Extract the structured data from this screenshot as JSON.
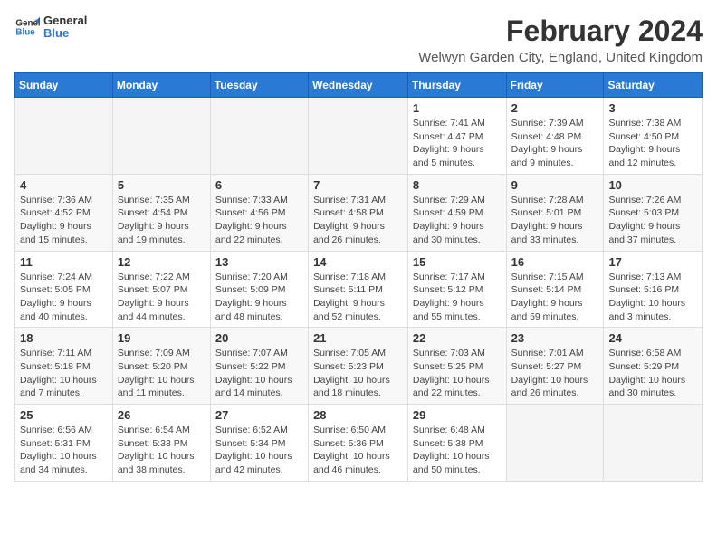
{
  "logo": {
    "text_general": "General",
    "text_blue": "Blue"
  },
  "header": {
    "title": "February 2024",
    "subtitle": "Welwyn Garden City, England, United Kingdom"
  },
  "weekdays": [
    "Sunday",
    "Monday",
    "Tuesday",
    "Wednesday",
    "Thursday",
    "Friday",
    "Saturday"
  ],
  "weeks": [
    [
      {
        "day": "",
        "info": ""
      },
      {
        "day": "",
        "info": ""
      },
      {
        "day": "",
        "info": ""
      },
      {
        "day": "",
        "info": ""
      },
      {
        "day": "1",
        "info": "Sunrise: 7:41 AM\nSunset: 4:47 PM\nDaylight: 9 hours\nand 5 minutes."
      },
      {
        "day": "2",
        "info": "Sunrise: 7:39 AM\nSunset: 4:48 PM\nDaylight: 9 hours\nand 9 minutes."
      },
      {
        "day": "3",
        "info": "Sunrise: 7:38 AM\nSunset: 4:50 PM\nDaylight: 9 hours\nand 12 minutes."
      }
    ],
    [
      {
        "day": "4",
        "info": "Sunrise: 7:36 AM\nSunset: 4:52 PM\nDaylight: 9 hours\nand 15 minutes."
      },
      {
        "day": "5",
        "info": "Sunrise: 7:35 AM\nSunset: 4:54 PM\nDaylight: 9 hours\nand 19 minutes."
      },
      {
        "day": "6",
        "info": "Sunrise: 7:33 AM\nSunset: 4:56 PM\nDaylight: 9 hours\nand 22 minutes."
      },
      {
        "day": "7",
        "info": "Sunrise: 7:31 AM\nSunset: 4:58 PM\nDaylight: 9 hours\nand 26 minutes."
      },
      {
        "day": "8",
        "info": "Sunrise: 7:29 AM\nSunset: 4:59 PM\nDaylight: 9 hours\nand 30 minutes."
      },
      {
        "day": "9",
        "info": "Sunrise: 7:28 AM\nSunset: 5:01 PM\nDaylight: 9 hours\nand 33 minutes."
      },
      {
        "day": "10",
        "info": "Sunrise: 7:26 AM\nSunset: 5:03 PM\nDaylight: 9 hours\nand 37 minutes."
      }
    ],
    [
      {
        "day": "11",
        "info": "Sunrise: 7:24 AM\nSunset: 5:05 PM\nDaylight: 9 hours\nand 40 minutes."
      },
      {
        "day": "12",
        "info": "Sunrise: 7:22 AM\nSunset: 5:07 PM\nDaylight: 9 hours\nand 44 minutes."
      },
      {
        "day": "13",
        "info": "Sunrise: 7:20 AM\nSunset: 5:09 PM\nDaylight: 9 hours\nand 48 minutes."
      },
      {
        "day": "14",
        "info": "Sunrise: 7:18 AM\nSunset: 5:11 PM\nDaylight: 9 hours\nand 52 minutes."
      },
      {
        "day": "15",
        "info": "Sunrise: 7:17 AM\nSunset: 5:12 PM\nDaylight: 9 hours\nand 55 minutes."
      },
      {
        "day": "16",
        "info": "Sunrise: 7:15 AM\nSunset: 5:14 PM\nDaylight: 9 hours\nand 59 minutes."
      },
      {
        "day": "17",
        "info": "Sunrise: 7:13 AM\nSunset: 5:16 PM\nDaylight: 10 hours\nand 3 minutes."
      }
    ],
    [
      {
        "day": "18",
        "info": "Sunrise: 7:11 AM\nSunset: 5:18 PM\nDaylight: 10 hours\nand 7 minutes."
      },
      {
        "day": "19",
        "info": "Sunrise: 7:09 AM\nSunset: 5:20 PM\nDaylight: 10 hours\nand 11 minutes."
      },
      {
        "day": "20",
        "info": "Sunrise: 7:07 AM\nSunset: 5:22 PM\nDaylight: 10 hours\nand 14 minutes."
      },
      {
        "day": "21",
        "info": "Sunrise: 7:05 AM\nSunset: 5:23 PM\nDaylight: 10 hours\nand 18 minutes."
      },
      {
        "day": "22",
        "info": "Sunrise: 7:03 AM\nSunset: 5:25 PM\nDaylight: 10 hours\nand 22 minutes."
      },
      {
        "day": "23",
        "info": "Sunrise: 7:01 AM\nSunset: 5:27 PM\nDaylight: 10 hours\nand 26 minutes."
      },
      {
        "day": "24",
        "info": "Sunrise: 6:58 AM\nSunset: 5:29 PM\nDaylight: 10 hours\nand 30 minutes."
      }
    ],
    [
      {
        "day": "25",
        "info": "Sunrise: 6:56 AM\nSunset: 5:31 PM\nDaylight: 10 hours\nand 34 minutes."
      },
      {
        "day": "26",
        "info": "Sunrise: 6:54 AM\nSunset: 5:33 PM\nDaylight: 10 hours\nand 38 minutes."
      },
      {
        "day": "27",
        "info": "Sunrise: 6:52 AM\nSunset: 5:34 PM\nDaylight: 10 hours\nand 42 minutes."
      },
      {
        "day": "28",
        "info": "Sunrise: 6:50 AM\nSunset: 5:36 PM\nDaylight: 10 hours\nand 46 minutes."
      },
      {
        "day": "29",
        "info": "Sunrise: 6:48 AM\nSunset: 5:38 PM\nDaylight: 10 hours\nand 50 minutes."
      },
      {
        "day": "",
        "info": ""
      },
      {
        "day": "",
        "info": ""
      }
    ]
  ]
}
